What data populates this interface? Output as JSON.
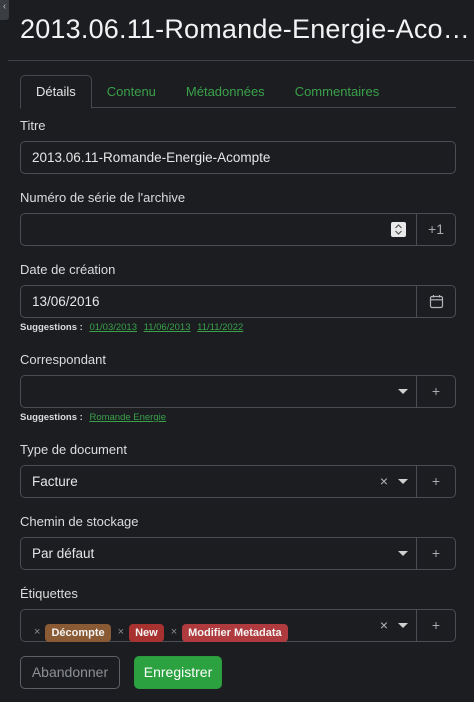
{
  "corner_tab": "‹",
  "title": "2013.06.11-Romande-Energie-Acompte",
  "tabs": [
    {
      "label": "Détails",
      "active": true
    },
    {
      "label": "Contenu",
      "active": false
    },
    {
      "label": "Métadonnées",
      "active": false
    },
    {
      "label": "Commentaires",
      "active": false
    }
  ],
  "fields": {
    "titre": {
      "label": "Titre",
      "value": "2013.06.11-Romande-Energie-Acompte"
    },
    "archive": {
      "label": "Numéro de série de l'archive",
      "value": "",
      "button": "+1"
    },
    "date": {
      "label": "Date de création",
      "value": "13/06/2016",
      "suggestions_label": "Suggestions :",
      "suggestions": [
        "01/03/2013",
        "11/06/2013",
        "11/11/2022"
      ]
    },
    "correspondant": {
      "label": "Correspondant",
      "value": "",
      "button": "+",
      "suggestions_label": "Suggestions :",
      "suggestions": [
        "Romande Energie"
      ]
    },
    "type": {
      "label": "Type de document",
      "value": "Facture",
      "clear": "×",
      "button": "+"
    },
    "chemin": {
      "label": "Chemin de stockage",
      "value": "Par défaut",
      "button": "+"
    },
    "etiquettes": {
      "label": "Étiquettes",
      "clear": "×",
      "button": "+",
      "tags": [
        {
          "label": "Décompte",
          "color": "#8a5a34"
        },
        {
          "label": "New",
          "color": "#a8322f"
        },
        {
          "label": "Modifier Metadata",
          "color": "#b03b3f"
        }
      ]
    }
  },
  "actions": {
    "cancel": "Abandonner",
    "save": "Enregistrer"
  },
  "colors": {
    "accent": "#2ba13f",
    "background": "#1b1d21",
    "border": "#4a4d53"
  }
}
